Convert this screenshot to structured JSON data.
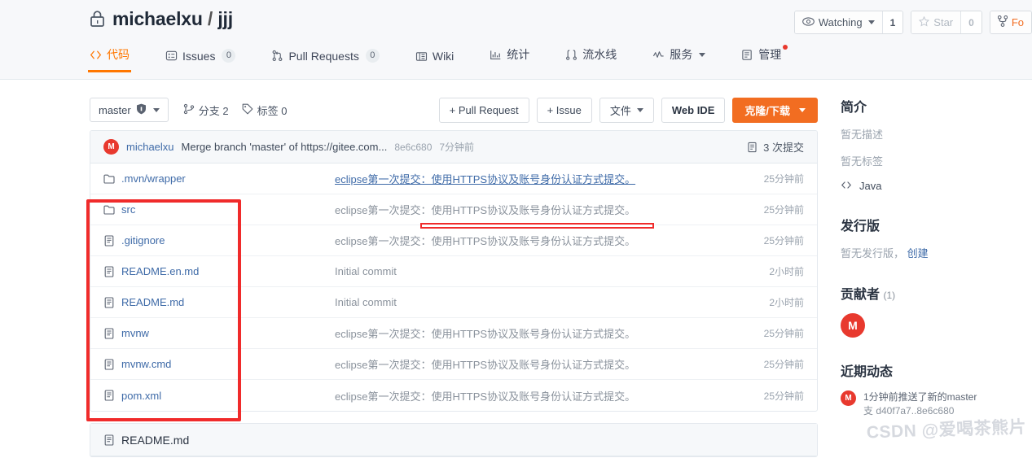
{
  "header": {
    "lock_icon": "lock-icon",
    "owner": "michaelxu",
    "separator": "/",
    "repo": "jjj",
    "watching_label": "Watching",
    "watching_count": "1",
    "star_label": "Star",
    "star_count": "0",
    "fork_label": "Fo",
    "watching_icon": "eye-icon",
    "star_icon": "star-icon",
    "fork_icon": "fork-icon"
  },
  "nav": {
    "items": [
      {
        "label": "代码",
        "icon": "code-icon",
        "badge": "",
        "active": true,
        "dot": false
      },
      {
        "label": "Issues",
        "icon": "issues-icon",
        "badge": "0",
        "active": false,
        "dot": false
      },
      {
        "label": "Pull Requests",
        "icon": "pull-request-icon",
        "badge": "0",
        "active": false,
        "dot": false
      },
      {
        "label": "Wiki",
        "icon": "wiki-icon",
        "badge": "",
        "active": false,
        "dot": false
      },
      {
        "label": "统计",
        "icon": "chart-icon",
        "badge": "",
        "active": false,
        "dot": false
      },
      {
        "label": "流水线",
        "icon": "pipeline-icon",
        "badge": "",
        "active": false,
        "dot": false
      },
      {
        "label": "服务",
        "icon": "service-icon",
        "badge": "",
        "active": false,
        "dot": false,
        "caret": true
      },
      {
        "label": "管理",
        "icon": "manage-icon",
        "badge": "",
        "active": false,
        "dot": true
      }
    ]
  },
  "toolbar": {
    "branch": "master",
    "branch_icon": "branch-shield-icon",
    "branches_label": "分支 2",
    "branches_icon": "branch-icon",
    "tags_label": "标签 0",
    "tags_icon": "tag-icon",
    "pull_request_label": "+ Pull Request",
    "issue_label": "+ Issue",
    "files_label": "文件",
    "web_ide_label": "Web IDE",
    "clone_label": "克隆/下载",
    "primary_color": "#f26d21"
  },
  "commit_bar": {
    "avatar_initial": "M",
    "author": "michaelxu",
    "message": "Merge branch 'master' of https://gitee.com...",
    "sha": "8e6c680",
    "time": "7分钟前",
    "commits_label": "3 次提交",
    "commits_icon": "history-icon"
  },
  "file_table": {
    "rows": [
      {
        "name": ".mvn/wrapper",
        "type": "folder",
        "icon": "folder-icon",
        "message": "eclipse第一次提交：使用HTTPS协议及账号身份认证方式提交。",
        "time": "25分钟前",
        "hovered": true
      },
      {
        "name": "src",
        "type": "folder",
        "icon": "folder-icon",
        "message": "eclipse第一次提交：使用HTTPS协议及账号身份认证方式提交。",
        "time": "25分钟前",
        "hovered": false
      },
      {
        "name": ".gitignore",
        "type": "file",
        "icon": "file-icon",
        "message": "eclipse第一次提交：使用HTTPS协议及账号身份认证方式提交。",
        "time": "25分钟前",
        "hovered": false
      },
      {
        "name": "README.en.md",
        "type": "file",
        "icon": "file-icon",
        "message": "Initial commit",
        "time": "2小时前",
        "hovered": false
      },
      {
        "name": "README.md",
        "type": "file",
        "icon": "file-icon",
        "message": "Initial commit",
        "time": "2小时前",
        "hovered": false
      },
      {
        "name": "mvnw",
        "type": "file",
        "icon": "file-icon",
        "message": "eclipse第一次提交：使用HTTPS协议及账号身份认证方式提交。",
        "time": "25分钟前",
        "hovered": false
      },
      {
        "name": "mvnw.cmd",
        "type": "file",
        "icon": "file-icon",
        "message": "eclipse第一次提交：使用HTTPS协议及账号身份认证方式提交。",
        "time": "25分钟前",
        "hovered": false
      },
      {
        "name": "pom.xml",
        "type": "file",
        "icon": "file-icon",
        "message": "eclipse第一次提交：使用HTTPS协议及账号身份认证方式提交。",
        "time": "25分钟前",
        "hovered": false
      }
    ]
  },
  "readme": {
    "title": "README.md",
    "icon": "file-icon"
  },
  "sidebar": {
    "intro_heading": "简介",
    "no_description": "暂无描述",
    "no_tags": "暂无标签",
    "language": "Java",
    "language_icon": "code-icon",
    "release_heading": "发行版",
    "no_release": "暂无发行版，",
    "create_link": "创建",
    "contributors_heading": "贡献者",
    "contributors_count": "(1)",
    "contributor_initial": "M",
    "activity_heading": "近期动态",
    "activity_avatar": "M",
    "activity_line1": "1分钟前推送了新的master",
    "activity_line2": "支  d40f7a7..8e6c680"
  },
  "annotations": {
    "box_color": "#f02b2b",
    "underline_color": "#f02b2b",
    "watermark": "CSDN @爱喝茶熊片"
  }
}
